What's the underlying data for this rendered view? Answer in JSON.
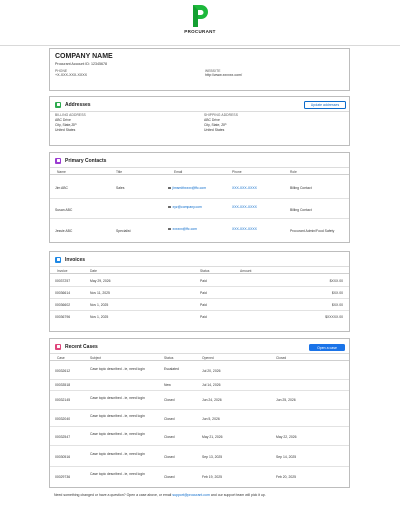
{
  "brand": {
    "name": "PROCURANT",
    "color": "#1cb83b"
  },
  "company": {
    "name": "COMPANY NAME",
    "account": "Procurant Account ID: 12345678",
    "phone_label": "PHONE",
    "phone": "+X-XXX-XXX-XXXX",
    "website_label": "WEBSITE",
    "website": "http://www.xxxxxx.com/"
  },
  "addresses": {
    "title": "Addresses",
    "icon_color": "#2eab4f",
    "update_label": "Update addresses",
    "billing": {
      "label": "BILLING ADDRESS",
      "line1": "ABC Drive",
      "line2": "City, State,ZIP",
      "line3": "United States"
    },
    "shipping": {
      "label": "SHIPPING ADDRESS",
      "line1": "ABC Drive",
      "line2": "City, State, ZIP",
      "line3": "United States"
    }
  },
  "contacts": {
    "title": "Primary Contacts",
    "icon_color": "#9b3cd1",
    "headers": [
      "Name",
      "Title",
      "Email",
      "Phone",
      "Role"
    ],
    "rows": [
      {
        "name": "Jim ABC",
        "title": "Sales",
        "email": "jimsmithxxxx@ffc.com",
        "phone": "XXX-XXX-XXXX",
        "role": "Billing Contact"
      },
      {
        "name": "Susan ABC",
        "title": "",
        "email": "xyz@company.com",
        "phone": "XXX-XXX-XXXX",
        "role": "Billing Contact"
      },
      {
        "name": "Jessie ABC",
        "title": "Specialist",
        "email": "xxxxxx@ffc.com",
        "phone": "XXX-XXX-XXXX",
        "role": "Procurant Admin/Food Safety"
      }
    ]
  },
  "invoices": {
    "title": "Invoices",
    "icon_color": "#1e88e5",
    "headers": [
      "Invoice",
      "Date",
      "Status",
      "Amount"
    ],
    "rows": [
      {
        "id": "00037257",
        "date": "May 29, 2026",
        "status": "Paid",
        "amount": "$XXX.00"
      },
      {
        "id": "00036614",
        "date": "Nov 11, 2025",
        "status": "Paid",
        "amount": "$XX.00"
      },
      {
        "id": "00036602",
        "date": "Nov 1, 2025",
        "status": "Paid",
        "amount": "$XX.00"
      },
      {
        "id": "00036796",
        "date": "Nov 1, 2025",
        "status": "Paid",
        "amount": "$XXXXX.00"
      }
    ]
  },
  "cases": {
    "title": "Recent Cases",
    "icon_color": "#e0457b",
    "open_label": "Open a case",
    "headers": [
      "Case",
      "Subject",
      "Status",
      "Opened",
      "Closed"
    ],
    "rows": [
      {
        "case": "00032612",
        "subject": "Case topic described - ie, need login",
        "status": "Escalated",
        "opened": "Jul 20, 2026",
        "closed": ""
      },
      {
        "case": "00033518",
        "subject": "",
        "status": "New",
        "opened": "Jul 14, 2026",
        "closed": ""
      },
      {
        "case": "00032145",
        "subject": "Case topic described - ie, need login",
        "status": "Closed",
        "opened": "Jun 24, 2026",
        "closed": "Jun 25, 2026"
      },
      {
        "case": "00032040",
        "subject": "Case topic described - ie, need login",
        "status": "Closed",
        "opened": "Jun 5, 2026",
        "closed": ""
      },
      {
        "case": "00032547",
        "subject": "Case topic described - ie, need login",
        "status": "Closed",
        "opened": "May 21, 2026",
        "closed": "May 22, 2026"
      },
      {
        "case": "00030516",
        "subject": "Case topic described - ie, need login",
        "status": "Closed",
        "opened": "Sep 13, 2025",
        "closed": "Sep 14, 2025"
      },
      {
        "case": "00029736",
        "subject": "Case topic described - ie, need login",
        "status": "Closed",
        "opened": "Feb 19, 2025",
        "closed": "Feb 20, 2025"
      }
    ]
  },
  "footer": {
    "text_before": "Need something changed or have a question? Open a case above, or email ",
    "email": "support@procurant.com",
    "text_after": " and our support team will pick it up."
  }
}
